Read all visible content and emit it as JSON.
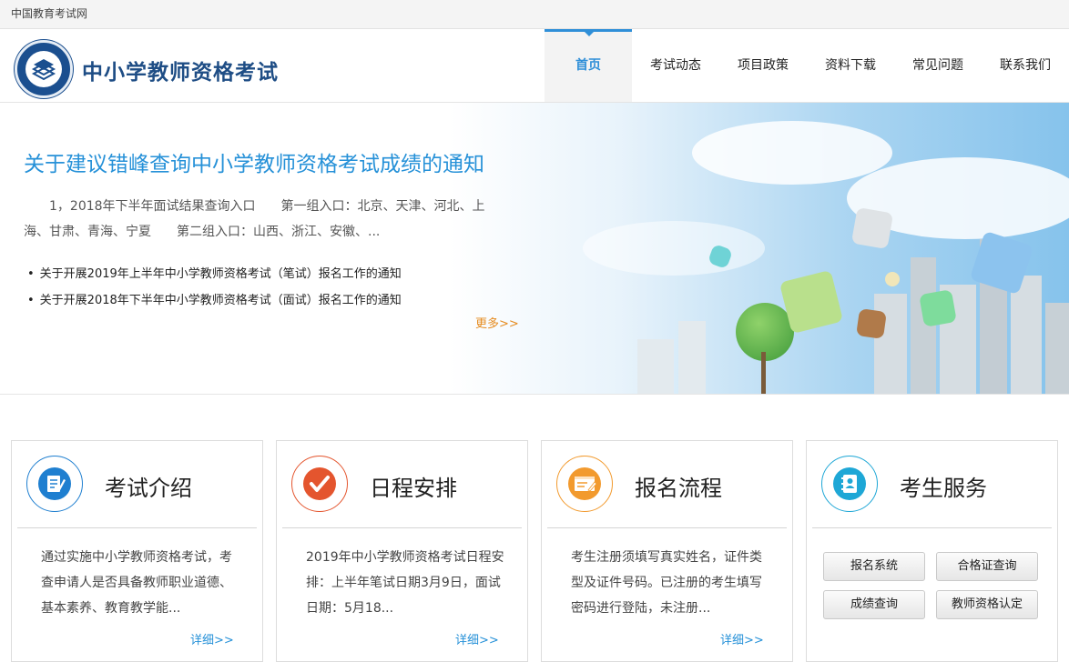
{
  "topbar": {
    "text": "中国教育考试网"
  },
  "header": {
    "title": "中小学教师资格考试",
    "nav": [
      {
        "label": "首页",
        "active": true
      },
      {
        "label": "考试动态"
      },
      {
        "label": "项目政策"
      },
      {
        "label": "资料下载"
      },
      {
        "label": "常见问题"
      },
      {
        "label": "联系我们"
      }
    ]
  },
  "banner": {
    "title": "关于建议错峰查询中小学教师资格考试成绩的通知",
    "desc": "1，2018年下半年面试结果查询入口　　第一组入口：北京、天津、河北、上海、甘肃、青海、宁夏　　第二组入口：山西、浙江、安徽、...",
    "news": [
      "关于开展2019年上半年中小学教师资格考试（笔试）报名工作的通知",
      "关于开展2018年下半年中小学教师资格考试（面试）报名工作的通知"
    ],
    "more": "更多>>"
  },
  "cards": [
    {
      "title": "考试介绍",
      "text": "通过实施中小学教师资格考试，考查申请人是否具备教师职业道德、基本素养、教育教学能...",
      "more": "详细>>",
      "icon": "exam-doc-icon",
      "color": "#1f7fd0"
    },
    {
      "title": "日程安排",
      "text": "2019年中小学教师资格考试日程安排：上半年笔试日期3月9日，面试日期：5月18...",
      "more": "详细>>",
      "icon": "checkmark-icon",
      "color": "#e4552e"
    },
    {
      "title": "报名流程",
      "text": "考生注册须填写真实姓名，证件类型及证件号码。已注册的考生填写密码进行登陆，未注册...",
      "more": "详细>>",
      "icon": "form-edit-icon",
      "color": "#f29a2e"
    },
    {
      "title": "考生服务",
      "icon": "contact-book-icon",
      "color": "#1ea7d6",
      "buttons": [
        "报名系统",
        "合格证查询",
        "成绩查询",
        "教师资格认定"
      ]
    }
  ]
}
